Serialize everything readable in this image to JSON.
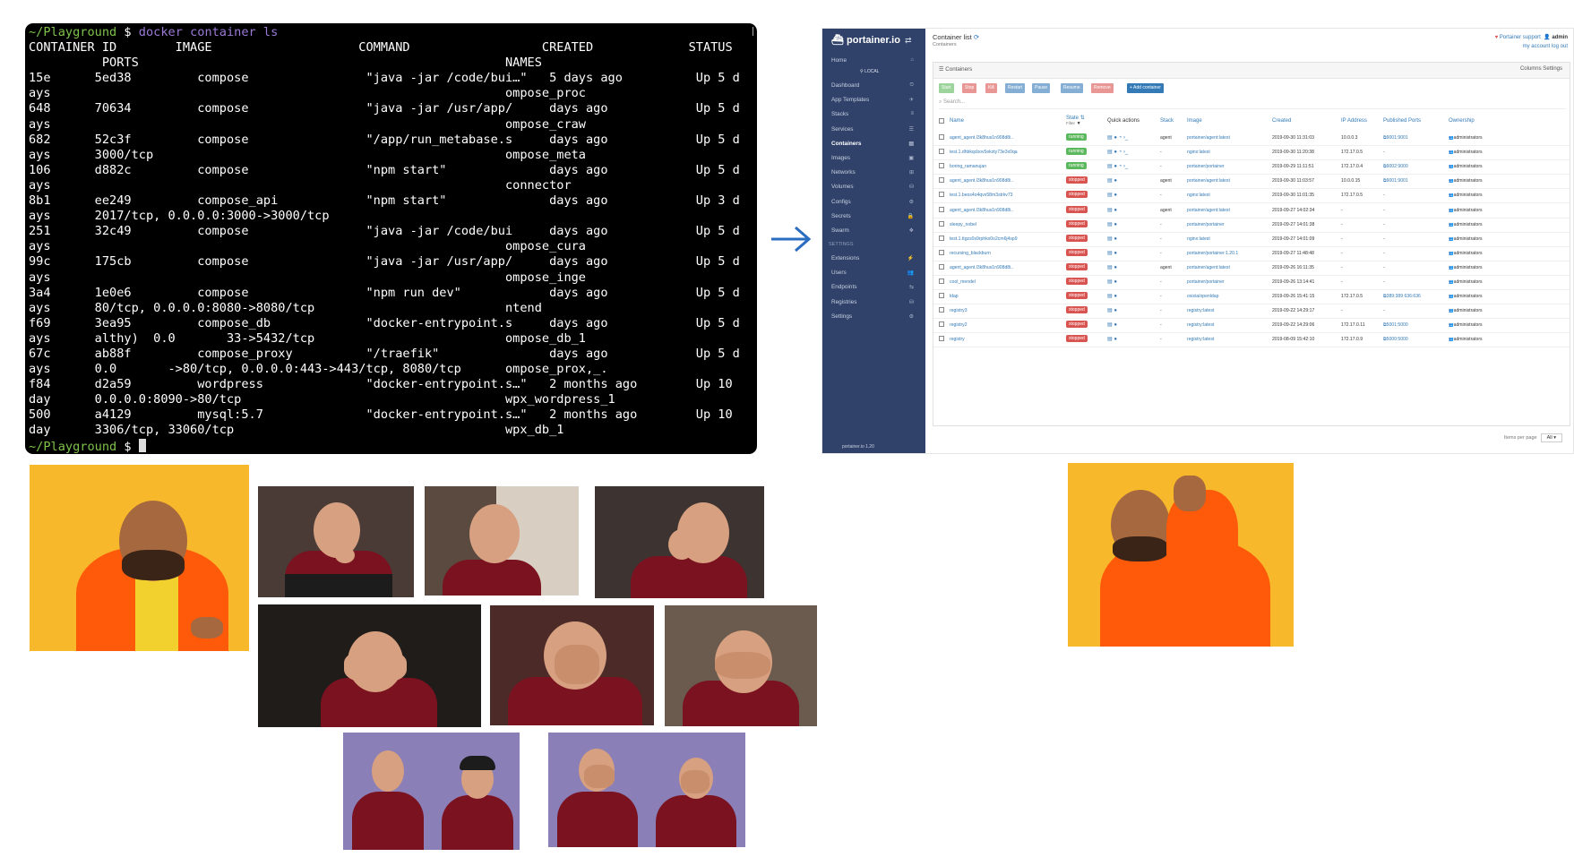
{
  "terminal": {
    "prompt_path": "~/Playground",
    "prompt_symbol": "$",
    "command": "docker container ls",
    "lines": [
      "CONTAINER ID        IMAGE                    COMMAND                  CREATED             STATUS",
      "          PORTS                                                  NAMES",
      "15e      5ed38         compose                \"java -jar /code/bui…\"   5 days ago          Up 5 d",
      "ays                                                              ompose_proc",
      "648      70634         compose                \"java -jar /usr/app/     days ago            Up 5 d",
      "ays                                                              ompose_craw",
      "682      52c3f         compose                \"/app/run_metabase.s     days ago            Up 5 d",
      "ays      3000/tcp                                                ompose_meta",
      "106      d882c         compose                \"npm start\"              days ago            Up 5 d",
      "ays                                                              connector",
      "8b1      ee249         compose_api            \"npm start\"              days ago            Up 3 d",
      "ays      2017/tcp, 0.0.0.0:3000->3000/tcp",
      "251      32c49         compose                \"java -jar /code/bui     days ago            Up 5 d",
      "ays                                                              ompose_cura",
      "99c      175cb         compose                \"java -jar /usr/app/     days ago            Up 5 d",
      "ays                                                              ompose_inge",
      "3a4      1e0e6         compose                \"npm run dev\"            days ago            Up 5 d",
      "ays      80/tcp, 0.0.0.0:8080->8080/tcp                          ntend",
      "f69      3ea95         compose_db             \"docker-entrypoint.s     days ago            Up 5 d",
      "ays      althy)  0.0       33->5432/tcp                          ompose_db_1",
      "67c      ab88f         compose_proxy          \"/traefik\"               days ago            Up 5 d",
      "ays      0.0       ->80/tcp, 0.0.0.0:443->443/tcp, 8080/tcp      ompose_prox,_.",
      "f84      d2a59         wordpress              \"docker-entrypoint.s…\"   2 months ago        Up 10",
      "day      0.0.0.0:8090->80/tcp                                    wpx_wordpress_1",
      "500      a4129         mysql:5.7              \"docker-entrypoint.s…\"   2 months ago        Up 10",
      "day      3306/tcp, 33060/tcp                                     wpx_db_1"
    ]
  },
  "portainer": {
    "logo": "portainer.io",
    "page_title": "Container list",
    "page_subtitle": "Containers",
    "support_link": "Portainer support",
    "user": "admin",
    "account_links": "my account   log out",
    "sidebar": {
      "home": "Home",
      "endpoint": "LOCAL",
      "items": [
        "Dashboard",
        "App Templates",
        "Stacks",
        "Services",
        "Containers",
        "Images",
        "Networks",
        "Volumes",
        "Configs",
        "Secrets",
        "Swarm"
      ],
      "settings_header": "SETTINGS",
      "settings_items": [
        "Extensions",
        "Users",
        "Endpoints",
        "Registries",
        "Settings"
      ],
      "version": "portainer.io 1.20"
    },
    "panel_title": "Containers",
    "panel_right": "Columns  Settings",
    "buttons": [
      "Start",
      "Stop",
      "Kill",
      "Restart",
      "Pause",
      "Resume",
      "Remove",
      "+ Add container"
    ],
    "search_placeholder": "Search...",
    "columns": [
      "Name",
      "State",
      "Filter",
      "Quick actions",
      "Stack",
      "Image",
      "Created",
      "IP Address",
      "Published Ports",
      "Ownership"
    ],
    "rows": [
      {
        "name": "agent_agent.l3k8hus1n908d8i..",
        "state": "running",
        "stack": "agent",
        "image": "portainer/agent:latest",
        "created": "2019-09-30 11:31:03",
        "ip": "10.0.0.3",
        "ports": "9001:9001",
        "owner": "administrators"
      },
      {
        "name": "test.1.dhbkqcbov5ekxty73e3x0qa",
        "state": "running",
        "stack": "-",
        "image": "nginx:latest",
        "created": "2019-09-30 11:20:38",
        "ip": "172.17.0.5",
        "ports": "-",
        "owner": "administrators"
      },
      {
        "name": "boring_ramanujan",
        "state": "running",
        "stack": "-",
        "image": "portainer/portainer",
        "created": "2019-09-29 11:11:51",
        "ip": "172.17.0.4",
        "ports": "9002:9000",
        "owner": "administrators"
      },
      {
        "name": "agent_agent.l3k8hus1n908d8i..",
        "state": "stopped",
        "stack": "agent",
        "image": "portainer/agent:latest",
        "created": "2019-09-30 11:03:57",
        "ip": "10.0.0.15",
        "ports": "9001:9001",
        "owner": "administrators"
      },
      {
        "name": "test.1.beos4o4qvx58m3strkv73",
        "state": "stopped",
        "stack": "-",
        "image": "nginx:latest",
        "created": "2019-09-30 11:01:35",
        "ip": "172.17.0.5",
        "ports": "-",
        "owner": "administrators"
      },
      {
        "name": "agent_agent.l3k8hus1n908d8i..",
        "state": "stopped",
        "stack": "agent",
        "image": "portainer/agent:latest",
        "created": "2019-09-27 14:02:34",
        "ip": "-",
        "ports": "-",
        "owner": "administrators"
      },
      {
        "name": "sleepy_nobel",
        "state": "stopped",
        "stack": "-",
        "image": "portainer/portainer",
        "created": "2019-09-27 14:01:38",
        "ip": "-",
        "ports": "-",
        "owner": "administrators"
      },
      {
        "name": "test.1.ttgzs0s9rphkx0o2cm6j4sp9",
        "state": "stopped",
        "stack": "-",
        "image": "nginx:latest",
        "created": "2019-09-27 14:01:09",
        "ip": "-",
        "ports": "-",
        "owner": "administrators"
      },
      {
        "name": "recursing_blackburn",
        "state": "stopped",
        "stack": "-",
        "image": "portainer/portainer:1.20.1",
        "created": "2019-09-27 11:48:48",
        "ip": "-",
        "ports": "-",
        "owner": "administrators"
      },
      {
        "name": "agent_agent.l3k8hus1n908d8i..",
        "state": "stopped",
        "stack": "agent",
        "image": "portainer/agent:latest",
        "created": "2019-09-26 16:11:35",
        "ip": "-",
        "ports": "-",
        "owner": "administrators"
      },
      {
        "name": "cool_mendel",
        "state": "stopped",
        "stack": "-",
        "image": "portainer/portainer",
        "created": "2019-09-26 13:14:41",
        "ip": "-",
        "ports": "-",
        "owner": "administrators"
      },
      {
        "name": "ldap",
        "state": "stopped",
        "stack": "-",
        "image": "osixia/openldap",
        "created": "2019-09-26 15:41:15",
        "ip": "172.17.0.5",
        "ports": "389:389  636:636",
        "owner": "administrators"
      },
      {
        "name": "registry3",
        "state": "stopped",
        "stack": "-",
        "image": "registry:latest",
        "created": "2019-09-22 14:29:17",
        "ip": "-",
        "ports": "-",
        "owner": "administrators"
      },
      {
        "name": "registry2",
        "state": "stopped",
        "stack": "-",
        "image": "registry:latest",
        "created": "2019-09-22 14:29:06",
        "ip": "172.17.0.11",
        "ports": "5001:5000",
        "owner": "administrators"
      },
      {
        "name": "registry",
        "state": "stopped",
        "stack": "-",
        "image": "registry:latest",
        "created": "2019-08-09 15:42:10",
        "ip": "172.17.0.9",
        "ports": "5000:5000",
        "owner": "administrators"
      }
    ],
    "items_per_page_label": "Items per page",
    "items_per_page_value": "All"
  },
  "colors": {
    "terminal_bg": "#000000",
    "prompt_green": "#7ec24a",
    "command_purple": "#9a7ad6",
    "sidebar_bg": "#30426a",
    "running": "#5cb85c",
    "stopped": "#d9534f",
    "link_blue": "#337ab7",
    "arrow_blue": "#2a6cc0",
    "drake_bg": "#f8b82b",
    "drake_jacket": "#ff5a0a"
  },
  "icons": {
    "arrow": "right-arrow-icon"
  }
}
